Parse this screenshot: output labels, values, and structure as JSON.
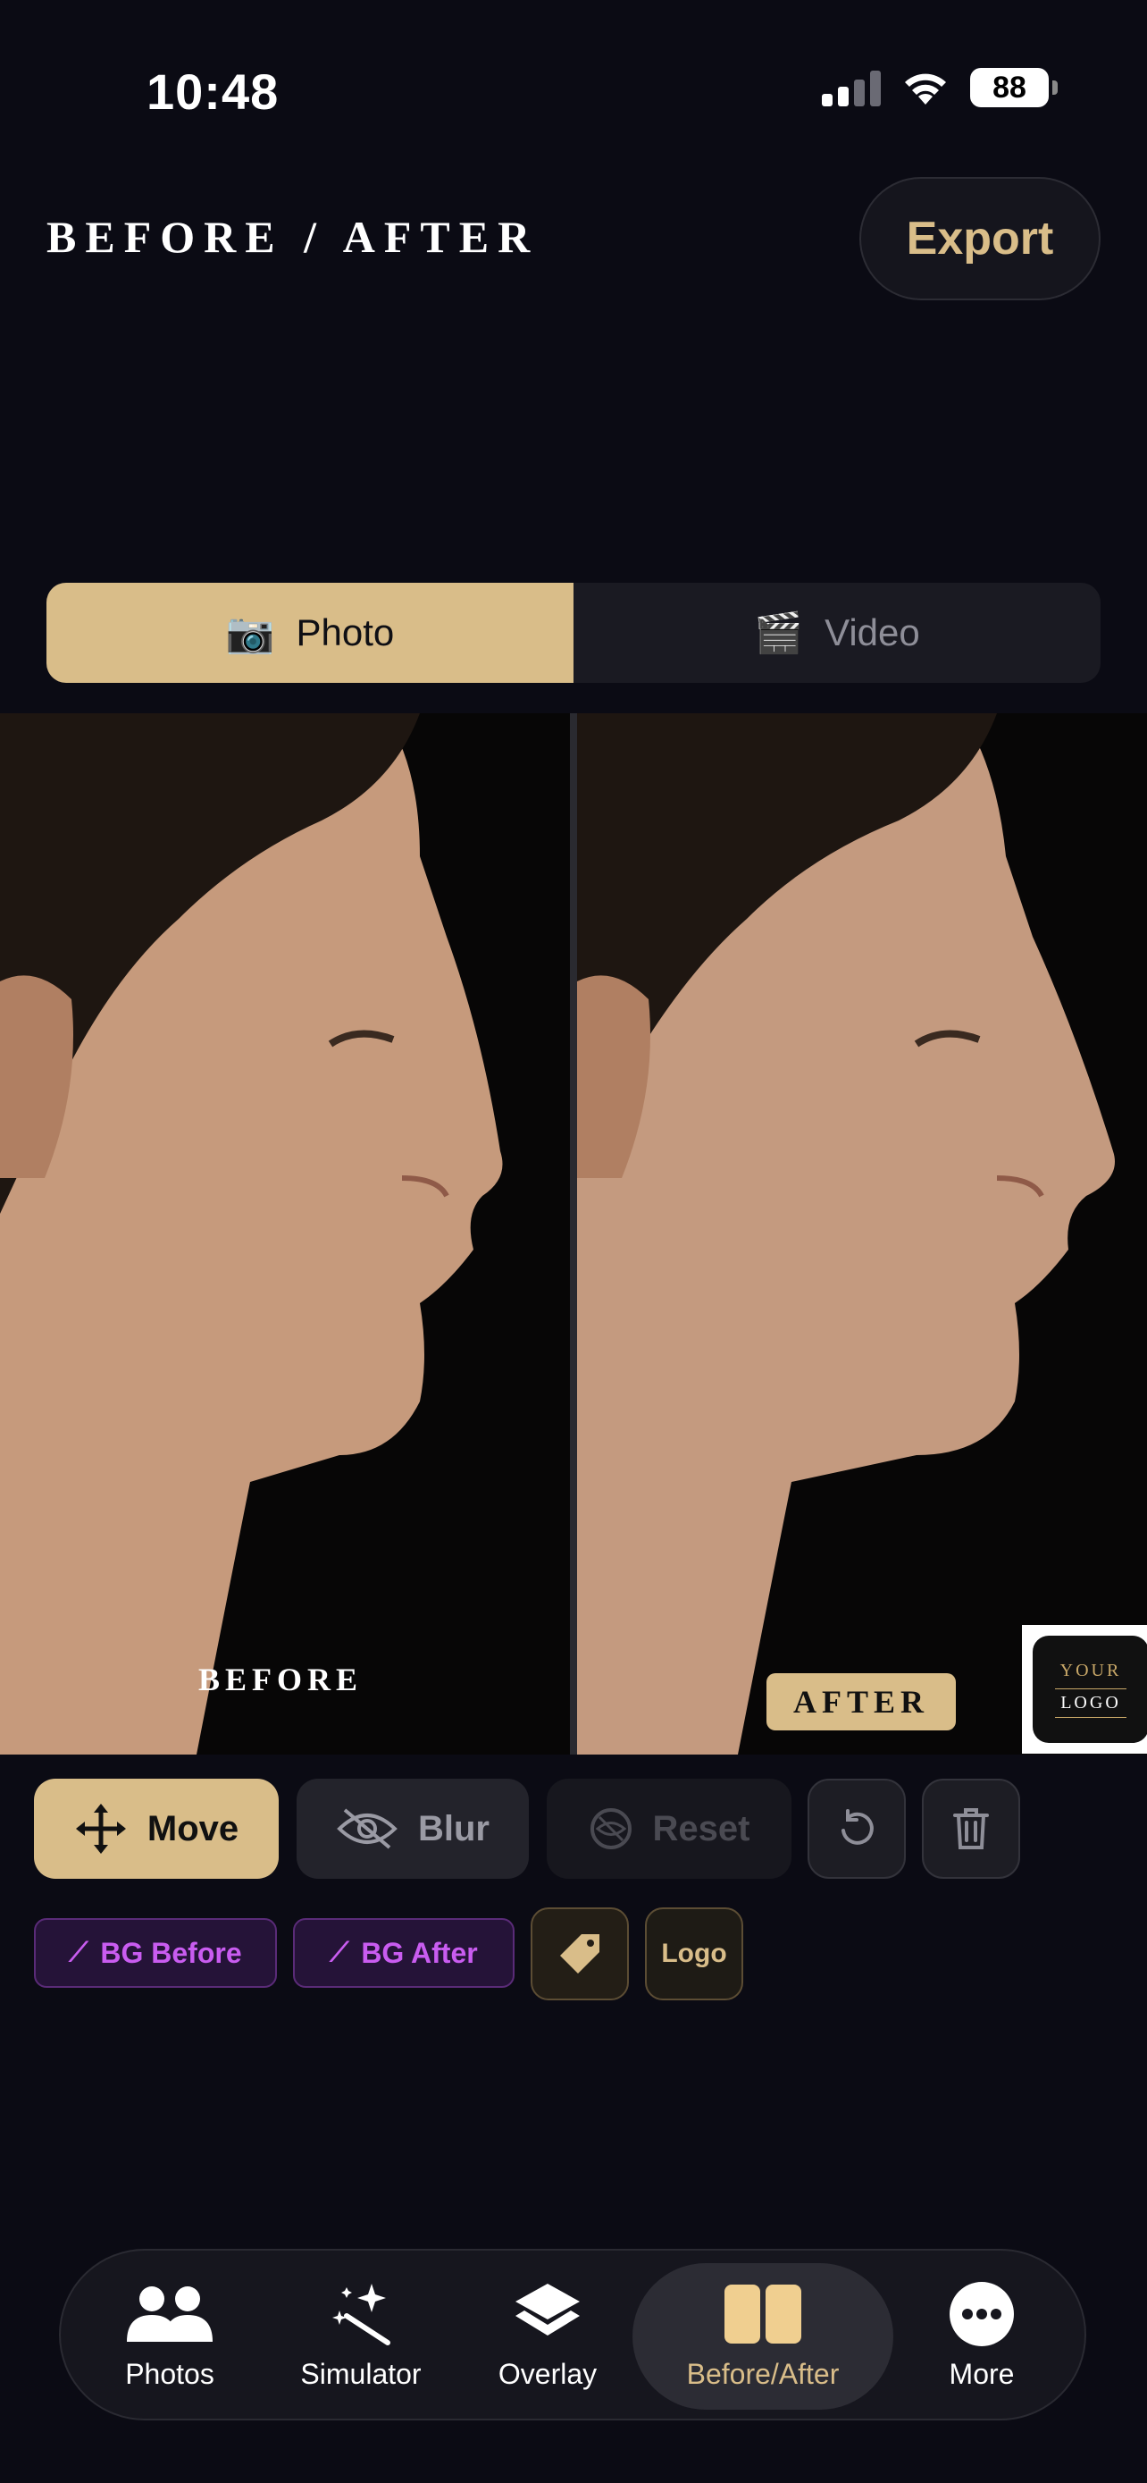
{
  "status_bar": {
    "time": "10:48",
    "battery": "88"
  },
  "header": {
    "title": "BEFORE / AFTER",
    "export_label": "Export"
  },
  "mode_tabs": [
    {
      "label": "Photo",
      "icon": "camera-icon",
      "active": true
    },
    {
      "label": "Video",
      "icon": "clapperboard-icon",
      "active": false
    }
  ],
  "canvas": {
    "before_label": "BEFORE",
    "after_label": "AFTER",
    "logo_top": "YOUR",
    "logo_main": "LOGO"
  },
  "tools": {
    "move": "Move",
    "blur": "Blur",
    "reset": "Reset",
    "bg_before": "BG Before",
    "bg_after": "BG After",
    "logo": "Logo"
  },
  "nav": [
    {
      "label": "Photos",
      "icon": "people-icon"
    },
    {
      "label": "Simulator",
      "icon": "magic-wand-icon"
    },
    {
      "label": "Overlay",
      "icon": "layers-icon"
    },
    {
      "label": "Before/After",
      "icon": "split-view-icon",
      "active": true
    },
    {
      "label": "More",
      "icon": "more-icon"
    }
  ],
  "colors": {
    "accent": "#d9bd89",
    "background": "#0b0b14",
    "purple": "#c95cf0"
  }
}
